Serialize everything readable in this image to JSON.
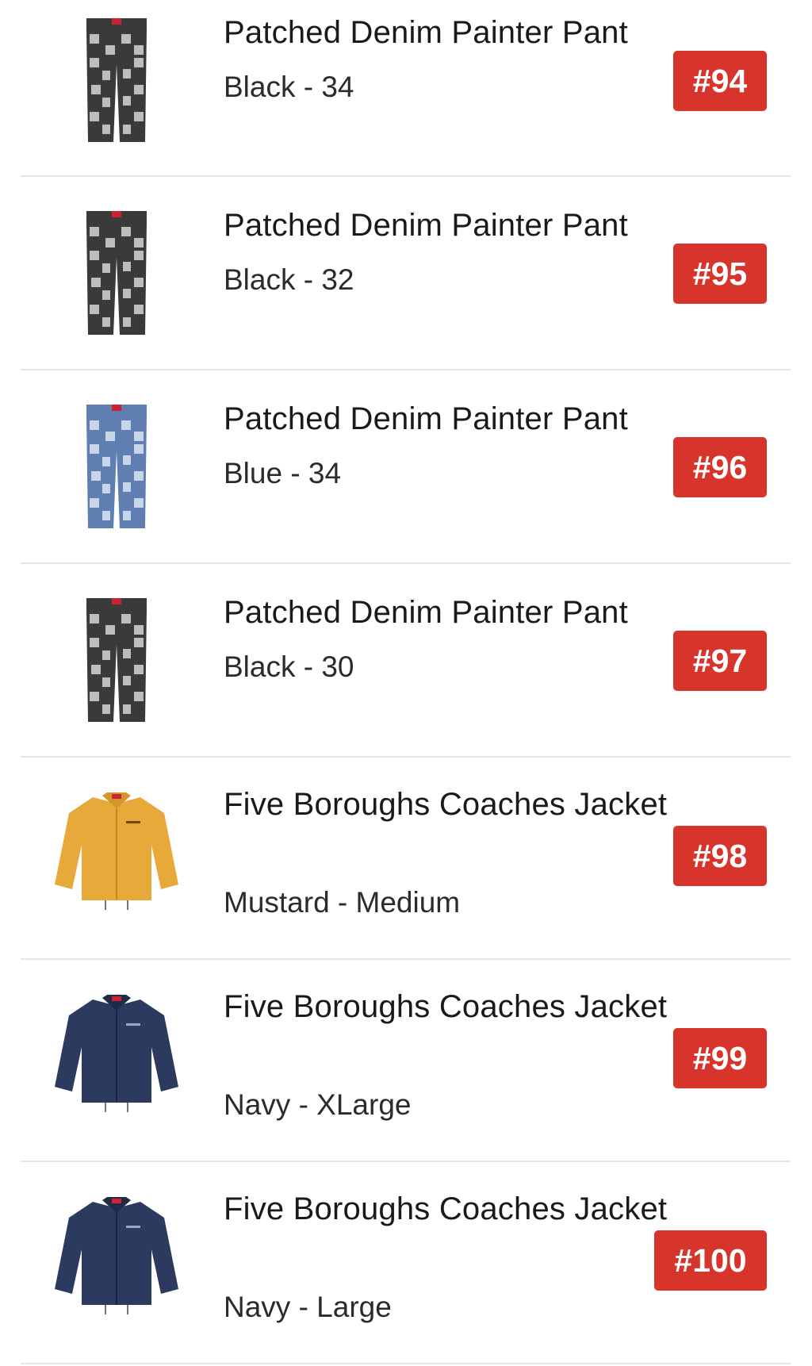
{
  "colors": {
    "badge": "#d7352b",
    "divider": "#e6e6e6",
    "text": "#1a1a1a"
  },
  "items": [
    {
      "title": "Patched Denim Painter Pant",
      "variant": "Black - 34",
      "rank": "#94",
      "image": "black-patched-pant-icon",
      "swatch": "#3a3a3a"
    },
    {
      "title": "Patched Denim Painter Pant",
      "variant": "Black - 32",
      "rank": "#95",
      "image": "black-patched-pant-icon",
      "swatch": "#3a3a3a"
    },
    {
      "title": "Patched Denim Painter Pant",
      "variant": "Blue - 34",
      "rank": "#96",
      "image": "blue-patched-pant-icon",
      "swatch": "#6f8fc0"
    },
    {
      "title": "Patched Denim Painter Pant",
      "variant": "Black - 30",
      "rank": "#97",
      "image": "black-patched-pant-icon",
      "swatch": "#3a3a3a"
    },
    {
      "title": "Five Boroughs Coaches Jacket",
      "variant": "Mustard - Medium",
      "rank": "#98",
      "image": "mustard-coaches-jacket-icon",
      "swatch": "#e6a93a"
    },
    {
      "title": "Five Boroughs Coaches Jacket",
      "variant": "Navy - XLarge",
      "rank": "#99",
      "image": "navy-coaches-jacket-icon",
      "swatch": "#2b3a5e"
    },
    {
      "title": "Five Boroughs Coaches Jacket",
      "variant": "Navy - Large",
      "rank": "#100",
      "image": "navy-coaches-jacket-icon",
      "swatch": "#2b3a5e"
    }
  ]
}
